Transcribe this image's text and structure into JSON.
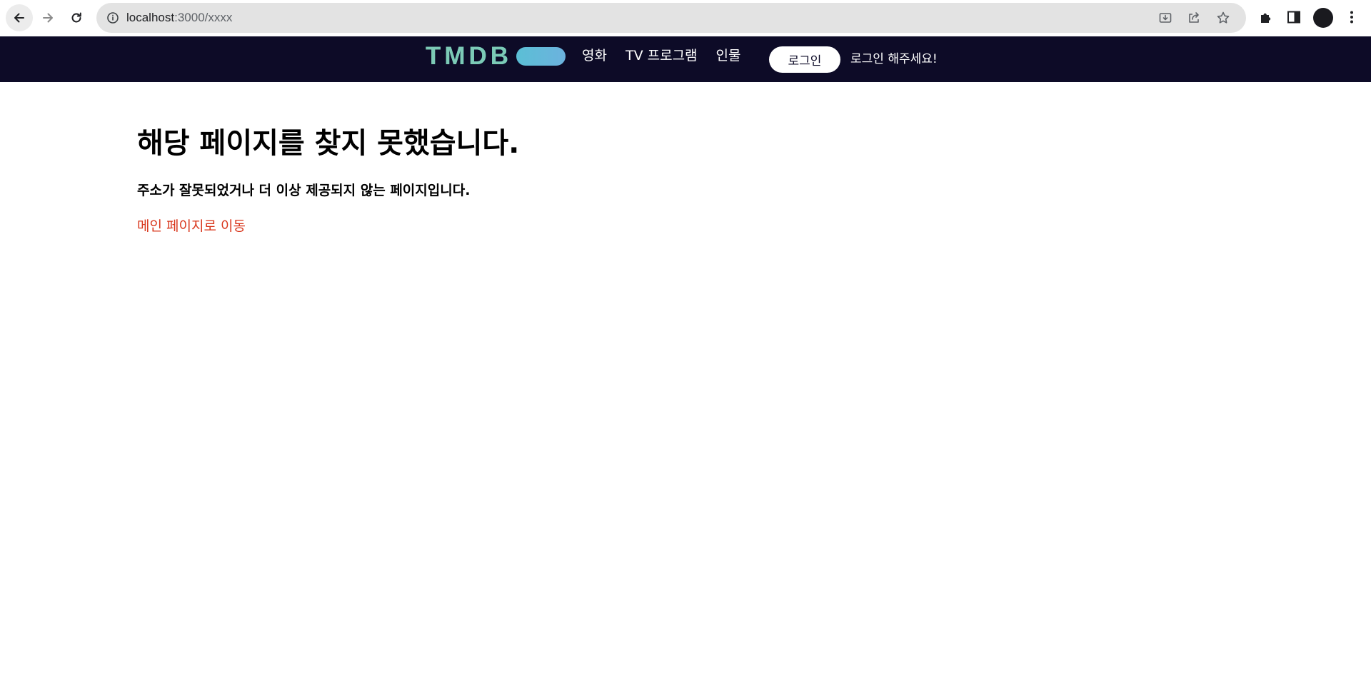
{
  "browser": {
    "url_host": "localhost",
    "url_path": ":3000/xxxx"
  },
  "header": {
    "logo_text": "TMDB",
    "nav": [
      "영화",
      "TV 프로그램",
      "인물"
    ],
    "login_label": "로그인",
    "login_message": "로그인 해주세요!"
  },
  "main": {
    "title": "해당 페이지를 찾지 못했습니다.",
    "description": "주소가 잘못되었거나 더 이상 제공되지 않는 페이지입니다.",
    "home_link": "메인 페이지로 이동"
  },
  "colors": {
    "header_bg": "#0d0b27",
    "link": "#d9381e",
    "logo_gradient_start": "#90cea1",
    "logo_gradient_end": "#01b4e4"
  },
  "icons": {
    "back": "arrow-left-icon",
    "forward": "arrow-right-icon",
    "reload": "reload-icon",
    "site_info": "info-icon",
    "install": "install-app-icon",
    "share": "share-icon",
    "bookmark": "star-icon",
    "extensions": "puzzle-icon",
    "side_panel": "side-panel-icon",
    "menu": "kebab-menu-icon"
  }
}
